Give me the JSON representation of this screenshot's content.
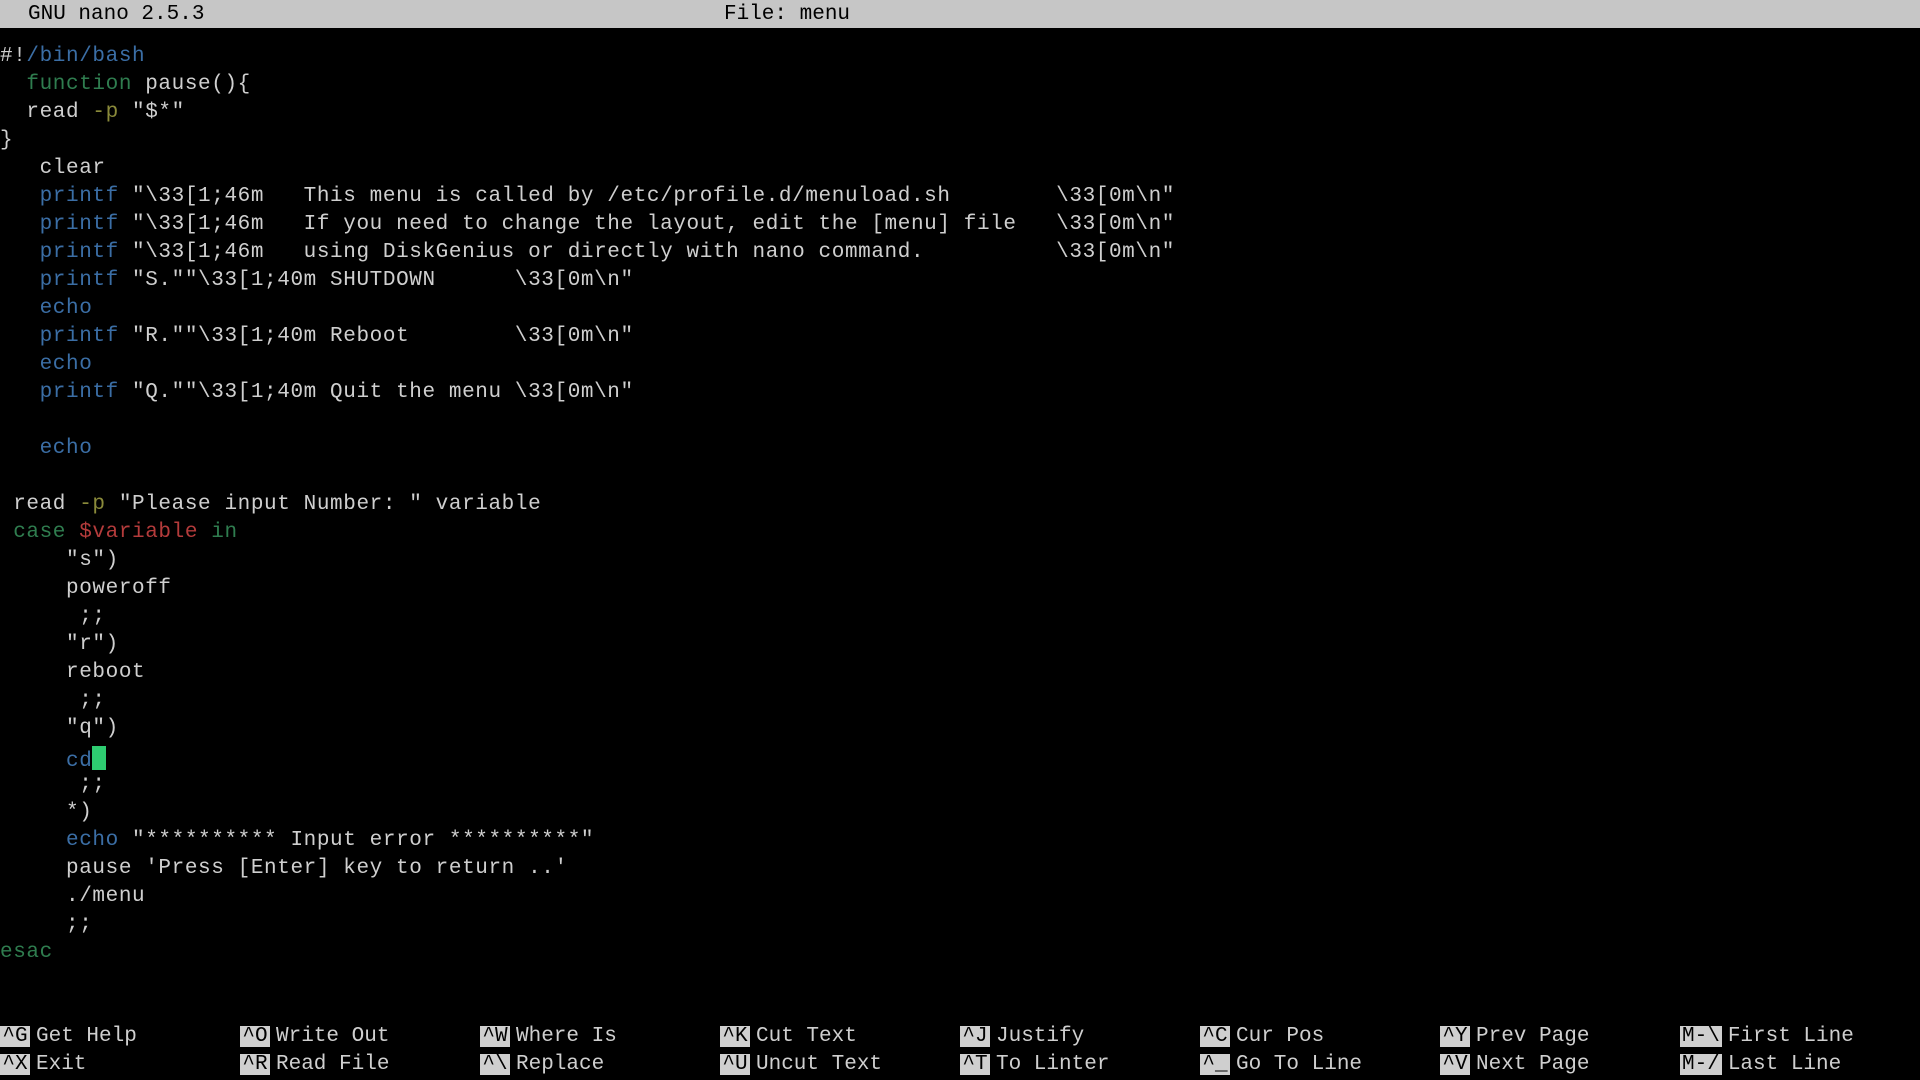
{
  "titlebar": {
    "app": "  GNU nano 2.5.3",
    "file": "File: menu"
  },
  "code": [
    [
      [
        "grey",
        "#!"
      ],
      [
        "blue",
        "/bin/bash"
      ]
    ],
    [
      [
        "grey",
        "  "
      ],
      [
        "dgreen",
        "function "
      ],
      [
        "grey",
        "pause(){"
      ]
    ],
    [
      [
        "grey",
        "  read "
      ],
      [
        "olive",
        "-p"
      ],
      [
        "grey",
        " \"$*\""
      ]
    ],
    [
      [
        "grey",
        "}"
      ]
    ],
    [
      [
        "grey",
        "   clear"
      ]
    ],
    [
      [
        "grey",
        "   "
      ],
      [
        "blue",
        "printf"
      ],
      [
        "grey",
        " \"\\33[1;46m   This menu is called by /etc/profile.d/menuload.sh        \\33[0m\\n\""
      ]
    ],
    [
      [
        "grey",
        "   "
      ],
      [
        "blue",
        "printf"
      ],
      [
        "grey",
        " \"\\33[1;46m   If you need to change the layout, edit the [menu] file   \\33[0m\\n\""
      ]
    ],
    [
      [
        "grey",
        "   "
      ],
      [
        "blue",
        "printf"
      ],
      [
        "grey",
        " \"\\33[1;46m   using DiskGenius or directly with nano command.          \\33[0m\\n\""
      ]
    ],
    [
      [
        "grey",
        "   "
      ],
      [
        "blue",
        "printf"
      ],
      [
        "grey",
        " \"S.\"\"\\33[1;40m SHUTDOWN      \\33[0m\\n\""
      ]
    ],
    [
      [
        "grey",
        "   "
      ],
      [
        "blue",
        "echo"
      ]
    ],
    [
      [
        "grey",
        "   "
      ],
      [
        "blue",
        "printf"
      ],
      [
        "grey",
        " \"R.\"\"\\33[1;40m Reboot        \\33[0m\\n\""
      ]
    ],
    [
      [
        "grey",
        "   "
      ],
      [
        "blue",
        "echo"
      ]
    ],
    [
      [
        "grey",
        "   "
      ],
      [
        "blue",
        "printf"
      ],
      [
        "grey",
        " \"Q.\"\"\\33[1;40m Quit the menu \\33[0m\\n\""
      ]
    ],
    [
      [
        "grey",
        " "
      ]
    ],
    [
      [
        "grey",
        "   "
      ],
      [
        "blue",
        "echo"
      ]
    ],
    [
      [
        "grey",
        " "
      ]
    ],
    [
      [
        "grey",
        " read "
      ],
      [
        "olive",
        "-p"
      ],
      [
        "grey",
        " \"Please input Number: \" variable"
      ]
    ],
    [
      [
        "grey",
        " "
      ],
      [
        "dgreen",
        "case"
      ],
      [
        "grey",
        " "
      ],
      [
        "red",
        "$variable"
      ],
      [
        "grey",
        " "
      ],
      [
        "dgreen",
        "in"
      ]
    ],
    [
      [
        "grey",
        "     \"s\")"
      ]
    ],
    [
      [
        "grey",
        "     poweroff"
      ]
    ],
    [
      [
        "grey",
        "      ;;"
      ]
    ],
    [
      [
        "grey",
        "     \"r\")"
      ]
    ],
    [
      [
        "grey",
        "     reboot"
      ]
    ],
    [
      [
        "grey",
        "      ;;"
      ]
    ],
    [
      [
        "grey",
        "     \"q\")"
      ]
    ],
    [
      [
        "grey",
        "     "
      ],
      [
        "blue",
        "cd"
      ],
      [
        "cursor",
        ""
      ]
    ],
    [
      [
        "grey",
        "      ;;"
      ]
    ],
    [
      [
        "grey",
        "     *)"
      ]
    ],
    [
      [
        "grey",
        "     "
      ],
      [
        "blue",
        "echo"
      ],
      [
        "grey",
        " \"********** Input error **********\""
      ]
    ],
    [
      [
        "grey",
        "     pause 'Press [Enter] key to return ..'"
      ]
    ],
    [
      [
        "grey",
        "     ./menu"
      ]
    ],
    [
      [
        "grey",
        "     ;;"
      ]
    ],
    [
      [
        "dgreen",
        "esac"
      ]
    ]
  ],
  "shortcuts": {
    "row1": [
      {
        "key": "^G",
        "label": "Get Help"
      },
      {
        "key": "^O",
        "label": "Write Out"
      },
      {
        "key": "^W",
        "label": "Where Is"
      },
      {
        "key": "^K",
        "label": "Cut Text"
      },
      {
        "key": "^J",
        "label": "Justify"
      },
      {
        "key": "^C",
        "label": "Cur Pos"
      },
      {
        "key": "^Y",
        "label": "Prev Page"
      },
      {
        "key": "M-\\",
        "label": "First Line"
      }
    ],
    "row2": [
      {
        "key": "^X",
        "label": "Exit"
      },
      {
        "key": "^R",
        "label": "Read File"
      },
      {
        "key": "^\\",
        "label": "Replace"
      },
      {
        "key": "^U",
        "label": "Uncut Text"
      },
      {
        "key": "^T",
        "label": "To Linter"
      },
      {
        "key": "^_",
        "label": "Go To Line"
      },
      {
        "key": "^V",
        "label": "Next Page"
      },
      {
        "key": "M-/",
        "label": "Last Line"
      }
    ]
  }
}
